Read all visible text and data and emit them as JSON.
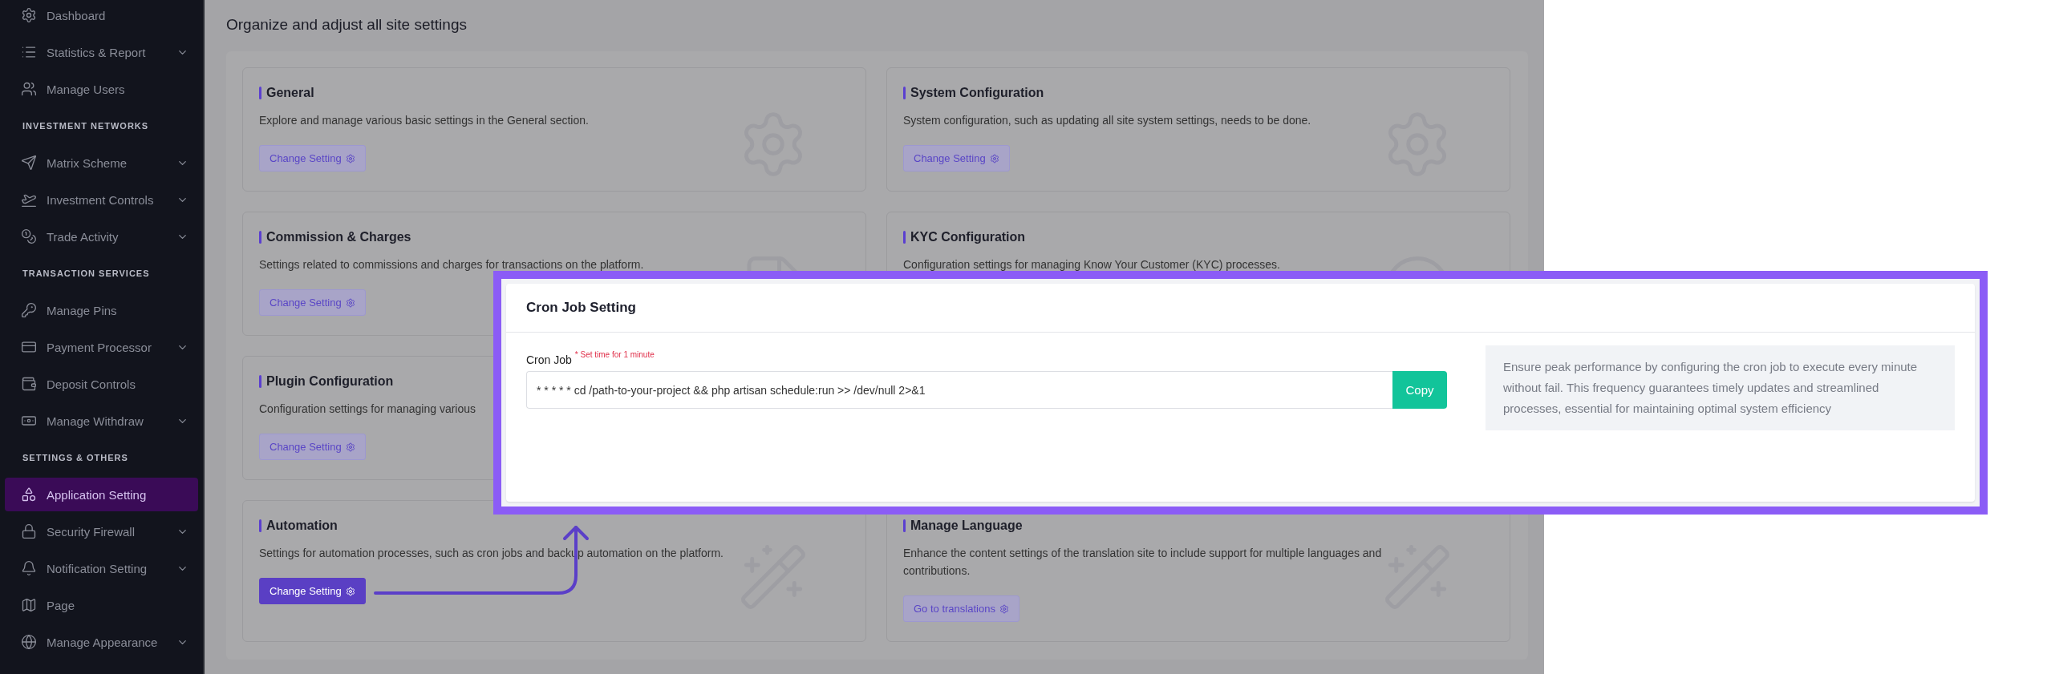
{
  "sidebar": {
    "sections": [
      {
        "items": [
          {
            "label": "Dashboard",
            "has_submenu": false,
            "selected": false
          },
          {
            "label": "Statistics & Report",
            "has_submenu": true,
            "selected": false
          },
          {
            "label": "Manage Users",
            "has_submenu": false,
            "selected": false
          }
        ]
      },
      {
        "heading": "INVESTMENT NETWORKS",
        "items": [
          {
            "label": "Matrix Scheme",
            "has_submenu": true,
            "selected": false
          },
          {
            "label": "Investment Controls",
            "has_submenu": true,
            "selected": false
          },
          {
            "label": "Trade Activity",
            "has_submenu": true,
            "selected": false
          }
        ]
      },
      {
        "heading": "TRANSACTION SERVICES",
        "items": [
          {
            "label": "Manage Pins",
            "has_submenu": false,
            "selected": false
          },
          {
            "label": "Payment Processor",
            "has_submenu": true,
            "selected": false
          },
          {
            "label": "Deposit Controls",
            "has_submenu": false,
            "selected": false
          },
          {
            "label": "Manage Withdraw",
            "has_submenu": true,
            "selected": false
          }
        ]
      },
      {
        "heading": "SETTINGS & OTHERS",
        "items": [
          {
            "label": "Application Setting",
            "has_submenu": false,
            "selected": true
          },
          {
            "label": "Security Firewall",
            "has_submenu": true,
            "selected": false
          },
          {
            "label": "Notification Setting",
            "has_submenu": true,
            "selected": false
          },
          {
            "label": "Page",
            "has_submenu": false,
            "selected": false
          },
          {
            "label": "Manage Appearance",
            "has_submenu": true,
            "selected": false
          }
        ]
      }
    ]
  },
  "page_title": "Organize and adjust all site settings",
  "card_rows": [
    [
      {
        "title": "General",
        "description": "Explore and manage various basic settings in the General section.",
        "button": {
          "label": "Change Setting",
          "selected": false
        }
      },
      {
        "title": "System Configuration",
        "description": "System configuration, such as updating all site system settings, needs to be done.",
        "button": {
          "label": "Change Setting",
          "selected": false
        }
      }
    ],
    [
      {
        "title": "Commission & Charges",
        "description": "Settings related to commissions and charges for transactions on the platform.",
        "button": {
          "label": "Change Setting",
          "selected": false
        }
      },
      {
        "title": "KYC Configuration",
        "description": "Configuration settings for managing Know Your Customer (KYC) processes."
      }
    ],
    [
      {
        "title": "Plugin Configuration",
        "description": "Configuration settings for managing various",
        "button": {
          "label": "Change Setting",
          "selected": false
        }
      }
    ],
    [
      {
        "title": "Automation",
        "description": "Settings for automation processes, such as cron jobs and backup automation on the platform.",
        "button": {
          "label": "Change Setting",
          "selected": true
        }
      },
      {
        "title": "Manage Language",
        "description": "Enhance the content settings of the translation site to include support for multiple languages and contributions.",
        "button": {
          "label": "Go to translations",
          "selected": false
        }
      }
    ]
  ],
  "cron_popup": {
    "title": "Cron Job Setting",
    "field_label": "Cron Job",
    "hint": "* Set time for 1 minute",
    "value": "* * * * * cd /path-to-your-project && php artisan schedule:run >> /dev/null 2>&1",
    "copy_button": "Copy",
    "info": "Ensure peak performance by configuring the cron job to execute every minute without fail. This frequency guarantees timely updates and streamlined processes, essential for maintaining optimal system efficiency"
  }
}
